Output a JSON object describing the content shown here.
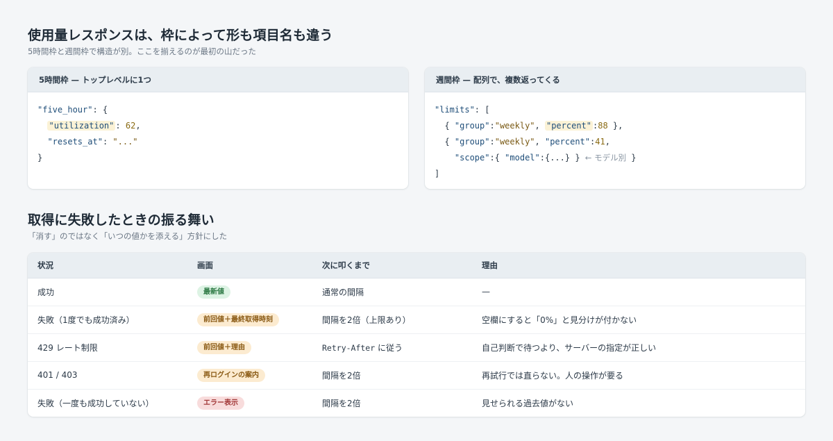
{
  "section1": {
    "title": "使用量レスポンスは、枠によって形も項目名も違う",
    "subtitle": "5時間枠と週間枠で構造が別。ここを揃えるのが最初の山だった",
    "cards": [
      {
        "header": "5時間枠 — トップレベルに1つ",
        "code": {
          "l1_key": "\"five_hour\"",
          "l1_rest": ": {",
          "l2_q1": "\"",
          "l2_key": "utilization",
          "l2_q2": "\"",
          "l2_colon": ": ",
          "l2_val": "62",
          "l2_end": ",",
          "l3_key": "\"resets_at\"",
          "l3_colon": ": ",
          "l3_val": "\"...\"",
          "l4": "}"
        }
      },
      {
        "header": "週間枠 — 配列で、複数返ってくる",
        "code": {
          "l1_key": "\"limits\"",
          "l1_rest": ": [",
          "l2_open": "{ ",
          "l2_k1": "\"group\"",
          "l2_c1": ":",
          "l2_v1": "\"weekly\"",
          "l2_sep": ", ",
          "l2_q1": "\"",
          "l2_k2": "percent",
          "l2_q2": "\"",
          "l2_c2": ":",
          "l2_v2": "88",
          "l2_close": " },",
          "l3_open": "{ ",
          "l3_k1": "\"group\"",
          "l3_c1": ":",
          "l3_v1": "\"weekly\"",
          "l3_sep": ", ",
          "l3_k2": "\"percent\"",
          "l3_c2": ":",
          "l3_v2": "41",
          "l3_end": ",",
          "l4_k": "\"scope\"",
          "l4_c": ":{ ",
          "l4_k2": "\"model\"",
          "l4_c2": ":{...} } ",
          "l4_comment": "← モデル別",
          "l4_close": " }",
          "l5": "]"
        }
      }
    ]
  },
  "section2": {
    "title": "取得に失敗したときの振る舞い",
    "subtitle": "「消す」のではなく「いつの値かを添える」方針にした",
    "columns": [
      "状況",
      "画面",
      "次に叩くまで",
      "理由"
    ],
    "rows": [
      {
        "situation": "成功",
        "badge": "最新値",
        "badge_tone": "green",
        "interval": "通常の間隔",
        "reason": "—"
      },
      {
        "situation": "失敗（1度でも成功済み）",
        "badge": "前回値＋最終取得時刻",
        "badge_tone": "orange",
        "interval": "間隔を2倍（上限あり）",
        "reason": "空欄にすると「0%」と見分けが付かない"
      },
      {
        "situation": "429 レート制限",
        "badge": "前回値＋理由",
        "badge_tone": "orange",
        "interval_code": "Retry-After",
        "interval_suffix": " に従う",
        "reason": "自己判断で待つより、サーバーの指定が正しい"
      },
      {
        "situation": "401 / 403",
        "badge": "再ログインの案内",
        "badge_tone": "orange",
        "interval": "間隔を2倍",
        "reason": "再試行では直らない。人の操作が要る"
      },
      {
        "situation": "失敗（一度も成功していない）",
        "badge": "エラー表示",
        "badge_tone": "red",
        "interval": "間隔を2倍",
        "reason": "見せられる過去値がない"
      }
    ]
  }
}
